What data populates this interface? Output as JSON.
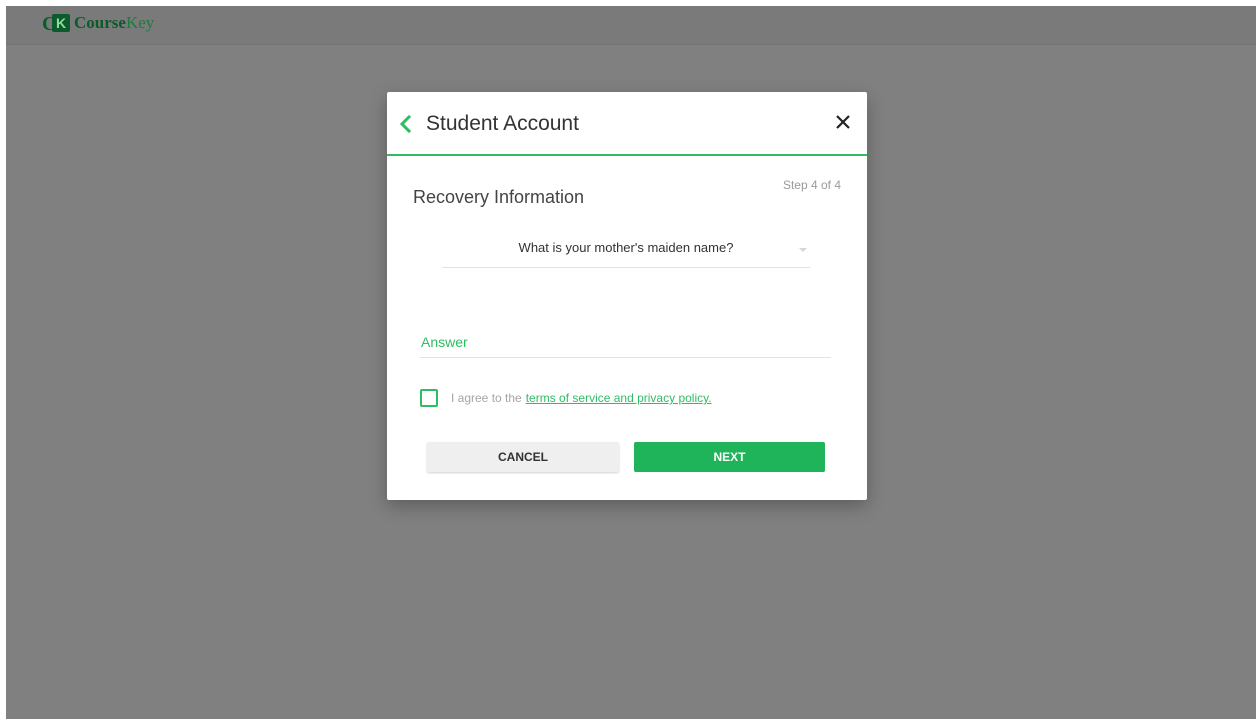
{
  "colors": {
    "accent": "#2ebd63",
    "accent_button": "#1fb35a",
    "overlay": "#808080",
    "brand_dark": "#0d5a2c"
  },
  "brand": {
    "logo_letters": "CK",
    "name_bold": "Course",
    "name_light": "Key"
  },
  "modal": {
    "title": "Student Account",
    "back_icon": "chevron-left-icon",
    "close_icon": "close-icon",
    "section_title": "Recovery Information",
    "step_label": "Step 4 of 4",
    "security_question": {
      "selected": "What is your mother's maiden name?"
    },
    "answer": {
      "value": "",
      "placeholder": "Answer"
    },
    "agree": {
      "checked": false,
      "prefix": "I agree to the",
      "link": "terms of service and privacy policy."
    },
    "buttons": {
      "cancel": "CANCEL",
      "next": "NEXT"
    }
  }
}
